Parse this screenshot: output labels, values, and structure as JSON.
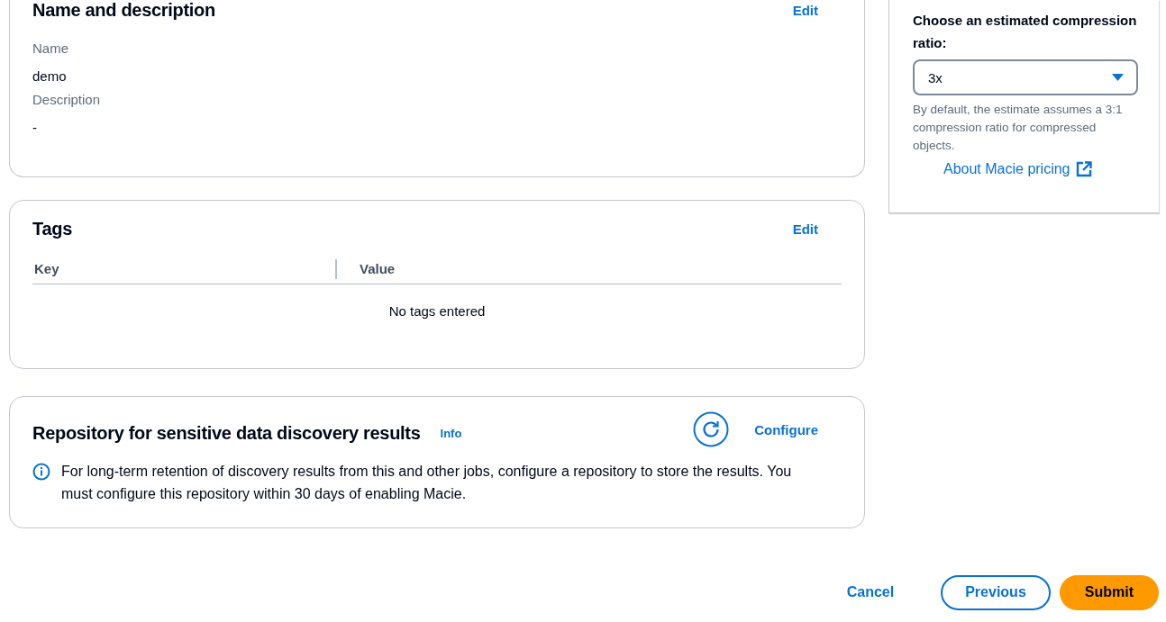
{
  "name_section": {
    "title": "Name and description",
    "edit": "Edit",
    "fields": [
      {
        "label": "Name",
        "value": "demo"
      },
      {
        "label": "Description",
        "value": "-"
      }
    ]
  },
  "tags_section": {
    "title": "Tags",
    "edit": "Edit",
    "columns": [
      "Key",
      "Value"
    ],
    "empty": "No tags entered"
  },
  "repository_section": {
    "title": "Repository for sensitive data discovery results",
    "info": "Info",
    "configure": "Configure",
    "message": "For long-term retention of discovery results from this and other jobs, configure a repository to store the results. You must configure this repository within 30 days of enabling Macie."
  },
  "estimate_panel": {
    "label": "Choose an estimated compression ratio:",
    "select_value": "3x",
    "hint": "By default, the estimate assumes a 3:1 compression ratio for compressed objects.",
    "link": "About Macie pricing"
  },
  "actions": [
    {
      "label": "Cancel",
      "kind": "link"
    },
    {
      "label": "Previous",
      "kind": "normal"
    },
    {
      "label": "Submit",
      "kind": "primary"
    }
  ]
}
